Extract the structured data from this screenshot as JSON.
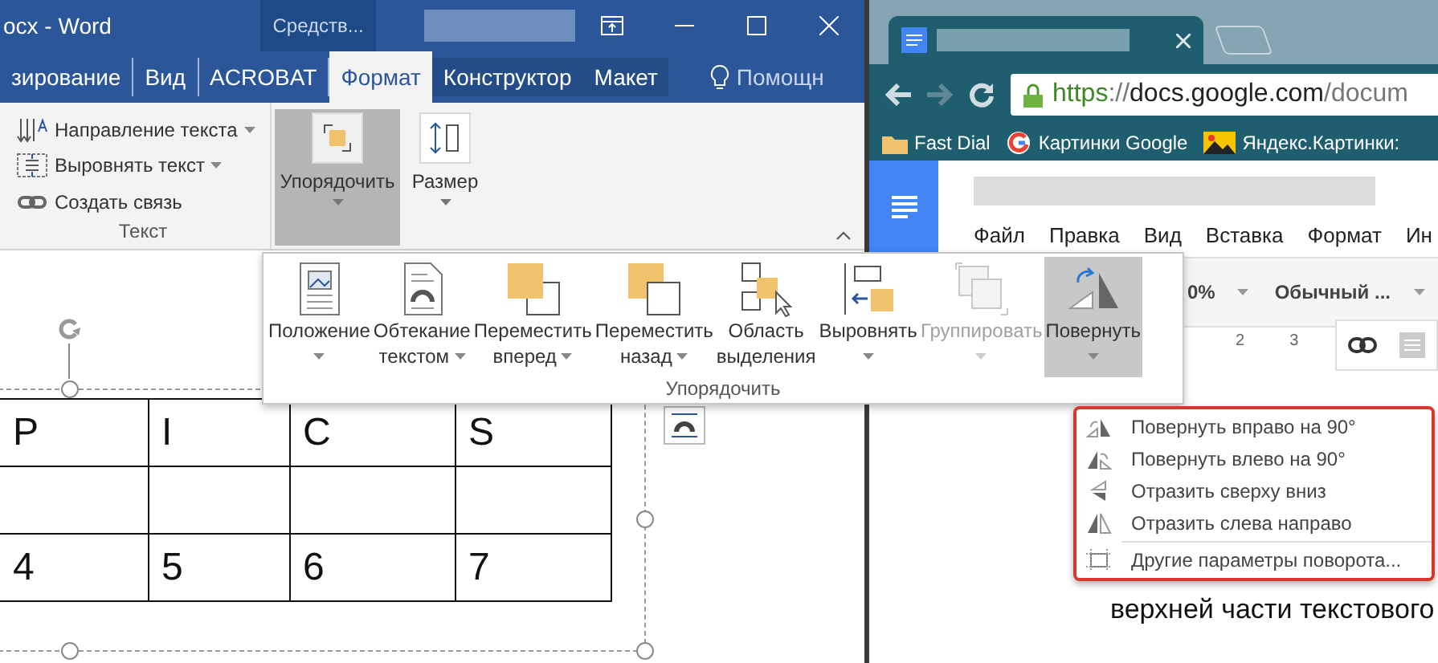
{
  "word": {
    "title": "ocx - Word",
    "context_group": "Средств...",
    "tabs": [
      {
        "label": "зирование",
        "selected": false,
        "contextual": false
      },
      {
        "label": "Вид",
        "selected": false,
        "contextual": false
      },
      {
        "label": "ACROBAT",
        "selected": false,
        "contextual": false
      },
      {
        "label": "Формат",
        "selected": true,
        "contextual": true
      },
      {
        "label": "Конструктор",
        "selected": false,
        "contextual": true
      },
      {
        "label": "Макет",
        "selected": false,
        "contextual": true
      }
    ],
    "tell_me": "Помощн",
    "text_group": {
      "label": "Текст",
      "items": [
        {
          "kind": "direction",
          "label": "Направление текста",
          "dropdown": true
        },
        {
          "kind": "align",
          "label": "Выровнять текст",
          "dropdown": true
        },
        {
          "kind": "link",
          "label": "Создать связь",
          "dropdown": false
        }
      ]
    },
    "ribbon_buttons": [
      {
        "kind": "arrange",
        "label": "Упорядочить",
        "selected": true
      },
      {
        "kind": "size",
        "label": "Размер",
        "selected": false
      }
    ],
    "table": {
      "rows": [
        [
          "P",
          "I",
          "C",
          "S"
        ],
        [
          null,
          null,
          null,
          null
        ],
        [
          "4",
          "5",
          "6",
          "7"
        ]
      ]
    }
  },
  "arrange_panel": {
    "label": "Упорядочить",
    "buttons": [
      {
        "kind": "position",
        "lines": [
          "Положение"
        ],
        "dropdown": true,
        "disabled": false,
        "selected": false
      },
      {
        "kind": "wrap",
        "lines": [
          "Обтекание",
          "текстом"
        ],
        "dropdown": true,
        "disabled": false,
        "selected": false
      },
      {
        "kind": "forward",
        "lines": [
          "Переместить",
          "вперед"
        ],
        "dropdown": true,
        "disabled": false,
        "selected": false
      },
      {
        "kind": "backward",
        "lines": [
          "Переместить",
          "назад"
        ],
        "dropdown": true,
        "disabled": false,
        "selected": false
      },
      {
        "kind": "pane",
        "lines": [
          "Область",
          "выделения"
        ],
        "dropdown": false,
        "disabled": false,
        "selected": false
      },
      {
        "kind": "align",
        "lines": [
          "Выровнять"
        ],
        "dropdown": true,
        "disabled": false,
        "selected": false
      },
      {
        "kind": "group",
        "lines": [
          "Группировать"
        ],
        "dropdown": true,
        "disabled": true,
        "selected": false
      },
      {
        "kind": "rotate",
        "lines": [
          "Повернуть"
        ],
        "dropdown": true,
        "disabled": false,
        "selected": true
      }
    ]
  },
  "rotate_menu": {
    "items": [
      {
        "kind": "rotate-right",
        "label": "Повернуть вправо на 90°"
      },
      {
        "kind": "rotate-left",
        "label": "Повернуть влево на 90°"
      },
      {
        "kind": "flip-vertical",
        "label": "Отразить сверху вниз"
      },
      {
        "kind": "flip-horizontal",
        "label": "Отразить слева направо"
      }
    ],
    "more": "Другие параметры поворота..."
  },
  "browser": {
    "url": {
      "scheme": "https",
      "separator": "://",
      "host": "docs.google.com",
      "path": "/docum"
    },
    "bookmarks": [
      {
        "kind": "folder",
        "label": "Fast Dial"
      },
      {
        "kind": "google",
        "label": "Картинки Google"
      },
      {
        "kind": "image",
        "label": "Яндекс.Картинки:"
      }
    ],
    "docs_menu": [
      "Файл",
      "Правка",
      "Вид",
      "Вставка",
      "Формат",
      "Ин"
    ],
    "zoom": "0%",
    "style": "Обычный ...",
    "ruler": [
      "2",
      "3"
    ],
    "body_text": "верхней части текстового"
  }
}
